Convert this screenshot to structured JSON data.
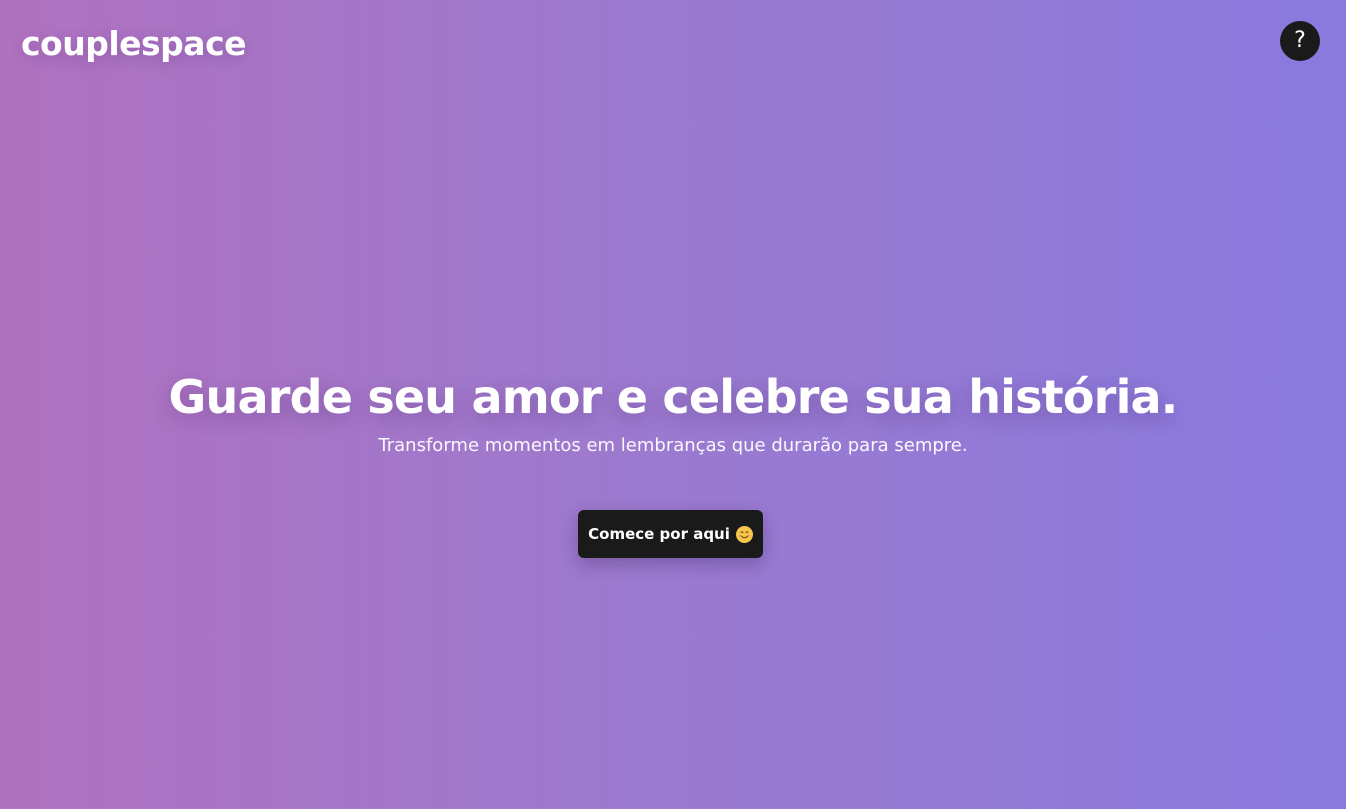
{
  "header": {
    "logo_text": "couplespace",
    "help_icon": "question-mark-icon",
    "help_label": "?"
  },
  "hero": {
    "title": "Guarde seu amor e celebre sua história.",
    "subtitle": "Transforme momentos em lembranças que durarão para sempre.",
    "cta_label": "Comece por aqui",
    "cta_icon": "smiling-face-icon"
  },
  "colors": {
    "gradient_start": "#b072c0",
    "gradient_end": "#897ade",
    "button_bg": "#1a1a1a",
    "text": "#ffffff"
  }
}
